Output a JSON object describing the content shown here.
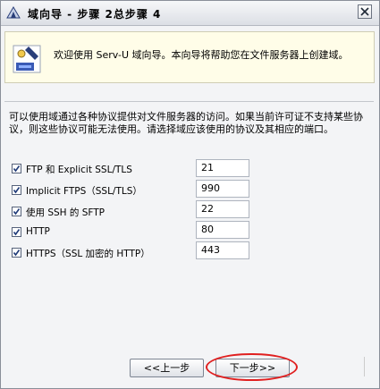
{
  "window": {
    "title": "域向导 - 步骤 2总步骤 4"
  },
  "banner": {
    "text": "欢迎使用 Serv-U 域向导。本向导将帮助您在文件服务器上创建域。"
  },
  "description": "可以使用域通过各种协议提供对文件服务器的访问。如果当前许可证不支持某些协议，则这些协议可能无法使用。请选择域应该使用的协议及其相应的端口。",
  "protocols": [
    {
      "label": "FTP 和 Explicit SSL/TLS",
      "checked": true,
      "port": "21"
    },
    {
      "label": "Implicit FTPS（SSL/TLS）",
      "checked": true,
      "port": "990"
    },
    {
      "label": "使用 SSH 的 SFTP",
      "checked": true,
      "port": "22"
    },
    {
      "label": "HTTP",
      "checked": true,
      "port": "80"
    },
    {
      "label": "HTTPS（SSL 加密的 HTTP）",
      "checked": true,
      "port": "443"
    }
  ],
  "buttons": {
    "back": "<<上一步",
    "next": "下一步>>"
  },
  "colors": {
    "banner_bg": "#fffde8",
    "highlight": "#e02020",
    "checkmark": "#1f3a78"
  }
}
